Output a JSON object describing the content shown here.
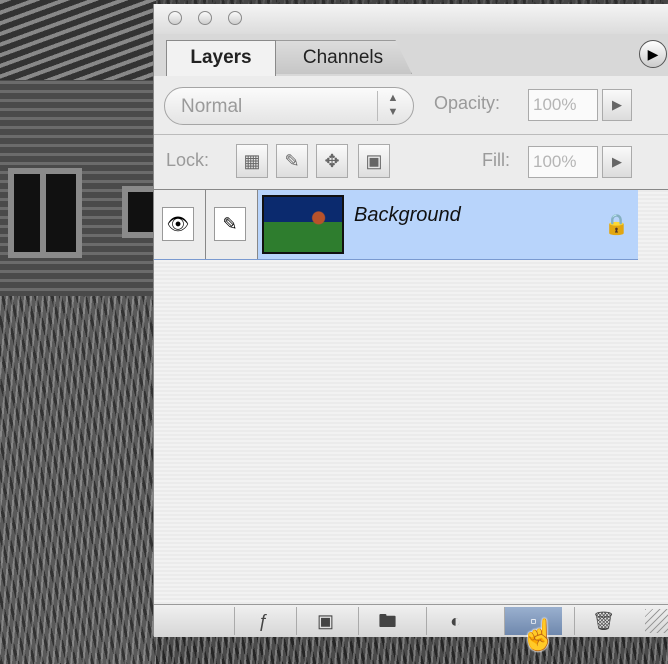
{
  "tabs": {
    "layers": "Layers",
    "channels": "Channels"
  },
  "controls": {
    "blend_mode": "Normal",
    "opacity_label": "Opacity:",
    "opacity_value": "100%",
    "lock_label": "Lock:",
    "fill_label": "Fill:",
    "fill_value": "100%"
  },
  "layers": [
    {
      "name": "Background",
      "visible": true,
      "locked": true,
      "selected": true
    }
  ],
  "icons": {
    "close": "circle-button-icon",
    "menu": "palette-menu-arrow-icon",
    "eye": "eye-icon",
    "brush": "paintbrush-icon",
    "lock": "lock-icon",
    "fx": "layer-style-icon",
    "mask": "layer-mask-icon",
    "folder": "folder-icon",
    "adjust": "adjustment-layer-icon",
    "new": "new-layer-icon",
    "trash": "trash-icon"
  },
  "colors": {
    "selected_row": "#b8d4fb",
    "panel": "#e8e8e8"
  }
}
